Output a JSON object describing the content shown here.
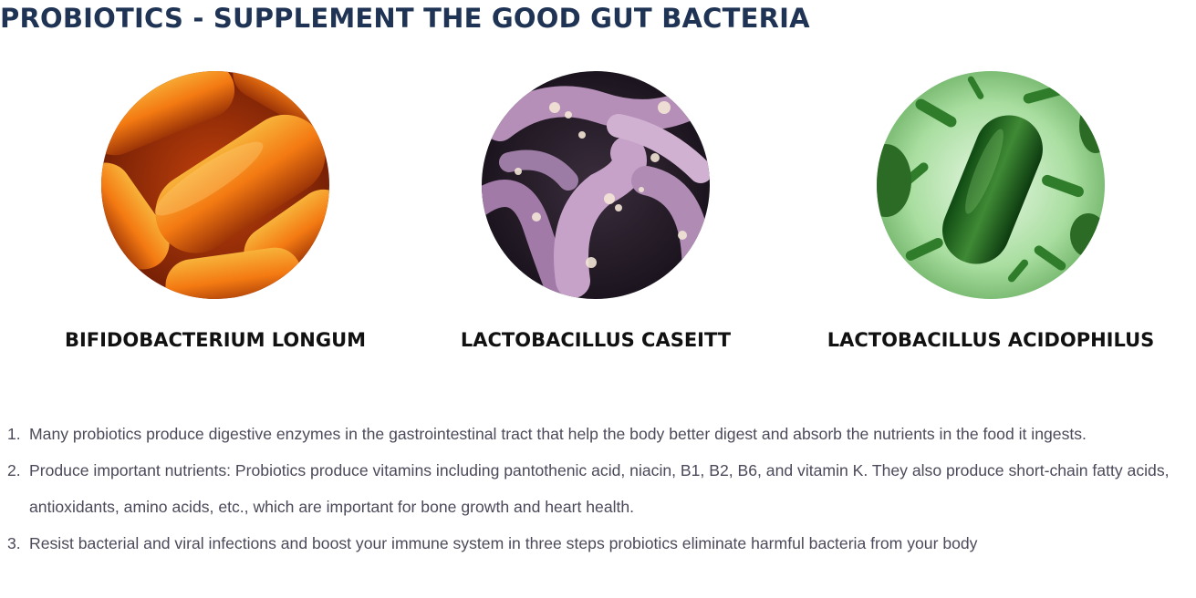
{
  "page": {
    "title": "PROBIOTICS - SUPPLEMENT THE GOOD GUT BACTERIA"
  },
  "strains": [
    {
      "name": "BIFIDOBACTERIUM LONGUM",
      "image": "orange-rod-bacteria-photo"
    },
    {
      "name": "LACTOBACILLUS CASEITT",
      "image": "purple-curved-bacteria-photo"
    },
    {
      "name": "LACTOBACILLUS ACIDOPHILUS",
      "image": "green-rod-bacteria-photo"
    }
  ],
  "benefits": [
    {
      "number": "1.",
      "text": "Many probiotics produce digestive enzymes in the gastrointestinal tract that help the body better digest and absorb the nutrients in the food it ingests."
    },
    {
      "number": "2.",
      "text": "Produce important nutrients: Probiotics produce vitamins including pantothenic acid, niacin, B1, B2, B6, and vitamin K. They also produce short-chain fatty acids, antioxidants, amino acids, etc., which are important for bone growth and heart health."
    },
    {
      "number": "3.",
      "text": "Resist bacterial and viral infections and boost your immune system in three steps probiotics eliminate harmful bacteria from your body"
    }
  ],
  "colors": {
    "title": "#1f3354",
    "strain_name": "#111111",
    "body_text": "#4a4a5a"
  }
}
